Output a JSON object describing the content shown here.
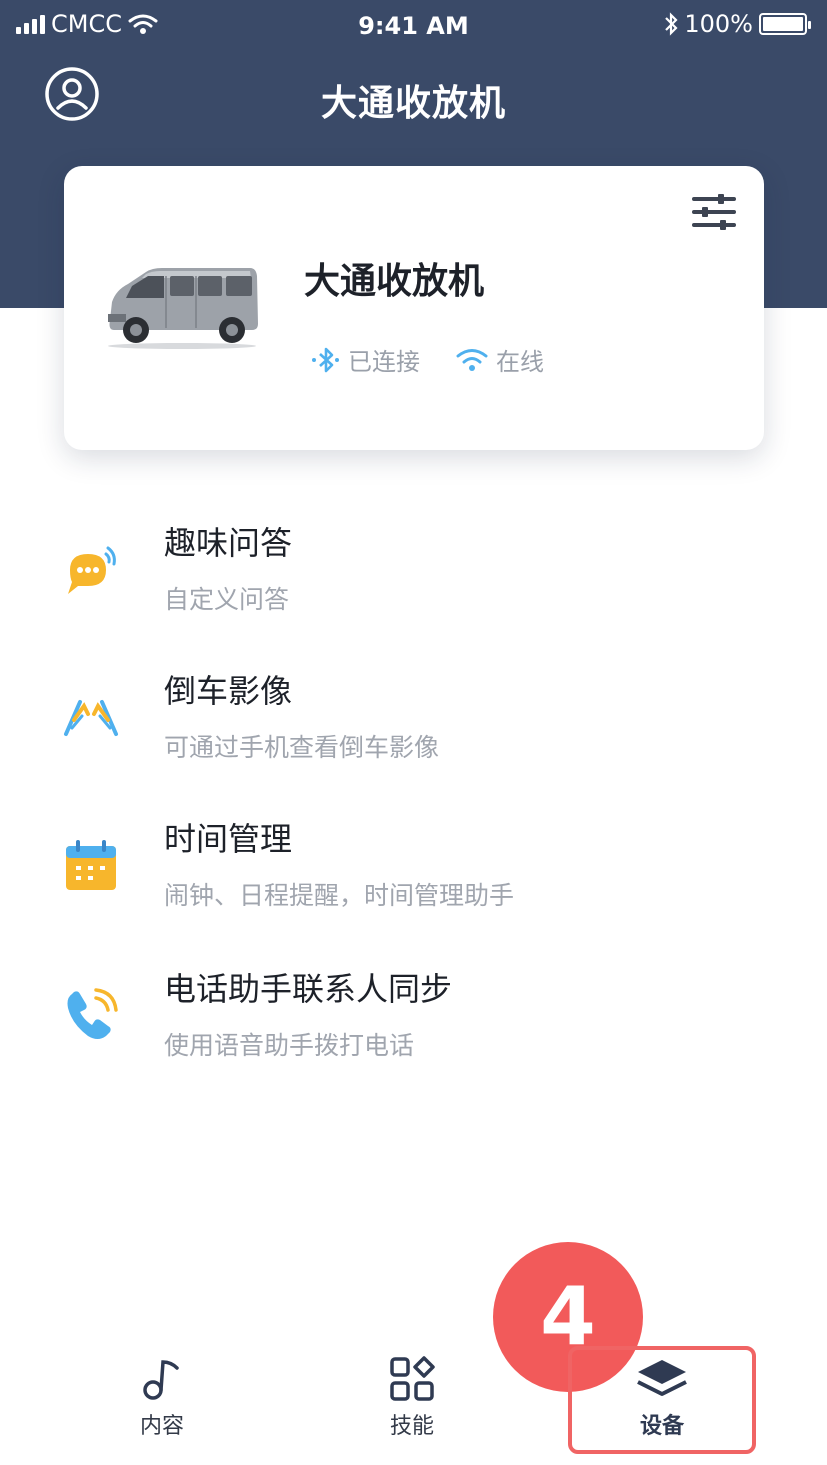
{
  "status_bar": {
    "carrier": "CMCC",
    "time": "9:41 AM",
    "battery": "100%",
    "battery_level": 1.0
  },
  "nav": {
    "title": "大通收放机"
  },
  "device": {
    "name": "大通收放机",
    "bluetooth_status": "已连接",
    "wifi_status": "在线"
  },
  "features": [
    {
      "title": "趣味问答",
      "subtitle": "自定义问答",
      "icon": "chat-bubble-icon"
    },
    {
      "title": "倒车影像",
      "subtitle": "可通过手机查看倒车影像",
      "icon": "reverse-camera-icon"
    },
    {
      "title": "时间管理",
      "subtitle": "闹钟、日程提醒，时间管理助手",
      "icon": "calendar-icon"
    },
    {
      "title": "电话助手联系人同步",
      "subtitle": "使用语音助手拨打电话",
      "icon": "phone-icon"
    }
  ],
  "annotation": {
    "step_number": "4"
  },
  "tabs": [
    {
      "label": "内容",
      "icon": "music-note-icon",
      "active": false
    },
    {
      "label": "技能",
      "icon": "grid-icon",
      "active": false
    },
    {
      "label": "设备",
      "icon": "layers-icon",
      "active": true
    }
  ],
  "colors": {
    "header": "#3a4a68",
    "accent": "#3aa0e8",
    "annotation": "#f25a5a"
  }
}
